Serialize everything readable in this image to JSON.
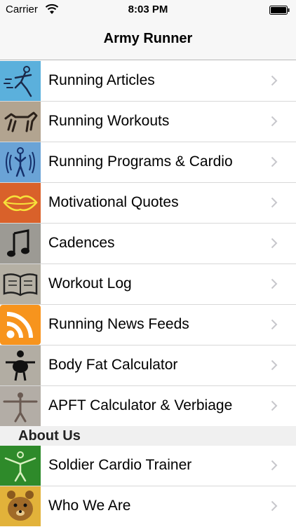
{
  "status_bar": {
    "carrier": "Carrier",
    "time": "8:03 PM"
  },
  "nav": {
    "title": "Army Runner"
  },
  "menu": {
    "items": [
      {
        "label": "Running Articles",
        "icon": "runner-figure-icon"
      },
      {
        "label": "Running Workouts",
        "icon": "horse-figure-icon"
      },
      {
        "label": "Running Programs & Cardio",
        "icon": "cardio-figure-icon"
      },
      {
        "label": "Motivational Quotes",
        "icon": "lips-icon"
      },
      {
        "label": "Cadences",
        "icon": "music-note-icon"
      },
      {
        "label": "Workout Log",
        "icon": "open-book-icon"
      },
      {
        "label": "Running News Feeds",
        "icon": "rss-icon"
      },
      {
        "label": "Body Fat Calculator",
        "icon": "body-figure-icon"
      },
      {
        "label": "APFT Calculator & Verbiage",
        "icon": "soldier-figure-icon"
      }
    ]
  },
  "about": {
    "header": "About Us",
    "items": [
      {
        "label": "Soldier Cardio Trainer",
        "icon": "cardio-trainer-icon"
      },
      {
        "label": "Who We Are",
        "icon": "bear-icon"
      }
    ]
  },
  "colors": {
    "nav_bg": "#f7f7f7",
    "separator": "#d8d8d8",
    "chevron": "#c7c7cc",
    "rss_orange": "#f7941d"
  }
}
